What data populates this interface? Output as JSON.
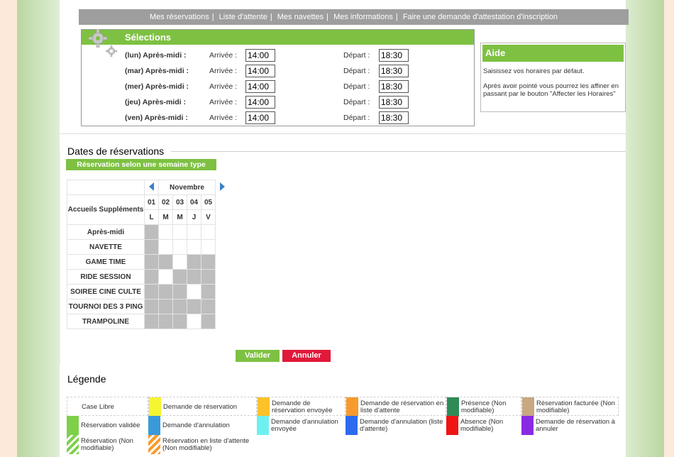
{
  "nav": {
    "items": [
      "Mes réservations",
      "Liste d'attente",
      "Mes navettes",
      "Mes informations",
      "Faire une demande d'attestation d'inscription"
    ]
  },
  "selections": {
    "title": "Sélections",
    "arrivee_label": "Arrivée :",
    "depart_label": "Départ :",
    "rows": [
      {
        "day": "(lun) Après-midi :",
        "arrivee": "14:00",
        "depart": "18:30"
      },
      {
        "day": "(mar) Après-midi :",
        "arrivee": "14:00",
        "depart": "18:30"
      },
      {
        "day": "(mer) Après-midi :",
        "arrivee": "14:00",
        "depart": "18:30"
      },
      {
        "day": "(jeu) Après-midi :",
        "arrivee": "14:00",
        "depart": "18:30"
      },
      {
        "day": "(ven) Après-midi :",
        "arrivee": "14:00",
        "depart": "18:30"
      }
    ]
  },
  "aide": {
    "title": "Aide",
    "text1": "Saisissez vos horaires par défaut.",
    "text2": "Après avoir pointé vous pourrez les affiner en passant par le bouton \"Affecter les Horaires\""
  },
  "dates": {
    "title": "Dates de réservations",
    "week_button": "Réservation selon une semaine type",
    "month": "Novembre",
    "header_label": "Accueils Suppléments",
    "days": [
      "01",
      "02",
      "03",
      "04",
      "05"
    ],
    "letters": [
      "L",
      "M",
      "M",
      "J",
      "V"
    ],
    "rows": [
      {
        "label": "Après-midi",
        "cells": [
          1,
          0,
          0,
          0,
          0
        ]
      },
      {
        "label": "NAVETTE",
        "cells": [
          1,
          0,
          0,
          0,
          0
        ]
      },
      {
        "label": "GAME TIME",
        "cells": [
          1,
          1,
          0,
          1,
          1
        ]
      },
      {
        "label": "RIDE SESSION",
        "cells": [
          1,
          0,
          1,
          1,
          1
        ]
      },
      {
        "label": "SOIREE CINE CULTE",
        "cells": [
          1,
          1,
          1,
          0,
          1
        ]
      },
      {
        "label": "TOURNOI DES 3 PING",
        "cells": [
          1,
          1,
          1,
          1,
          1
        ]
      },
      {
        "label": "TRAMPOLINE",
        "cells": [
          1,
          1,
          1,
          0,
          1
        ]
      }
    ]
  },
  "buttons": {
    "valider": "Valider",
    "annuler": "Annuler"
  },
  "legend": {
    "title": "Légende",
    "row1": [
      {
        "label": "Case Libre",
        "color": "#ffffff"
      },
      {
        "label": "Demande de réservation",
        "color": "#f5f532"
      },
      {
        "label": "Demande de réservation envoyée",
        "color": "#fcc22a"
      },
      {
        "label": "Demande de réservation en liste d'attente",
        "color": "#f89a2c"
      },
      {
        "label": "Présence (Non modifiable)",
        "color": "#2e8b57"
      },
      {
        "label": "Réservation facturée (Non modifiable)",
        "color": "#c8a882"
      }
    ],
    "row2": [
      {
        "label": "Réservation validée",
        "color": "#7ed04a"
      },
      {
        "label": "Demande d'annulation",
        "color": "#3a9ad9"
      },
      {
        "label": "Demande d'annulation envoyée",
        "color": "#6ef0f0"
      },
      {
        "label": "Demande d'annulation (liste d'attente)",
        "color": "#2d6cf0"
      },
      {
        "label": "Absence (Non modifiable)",
        "color": "#f01414"
      },
      {
        "label": "Demande de réservation à annuler",
        "color": "#8a2be2"
      }
    ],
    "row3": [
      {
        "label": "Réservation (Non modifiable)",
        "pattern": "green-hatched"
      },
      {
        "label": "Réservation en liste d'attente (Non modifiable)",
        "pattern": "orange-hatched"
      }
    ]
  }
}
